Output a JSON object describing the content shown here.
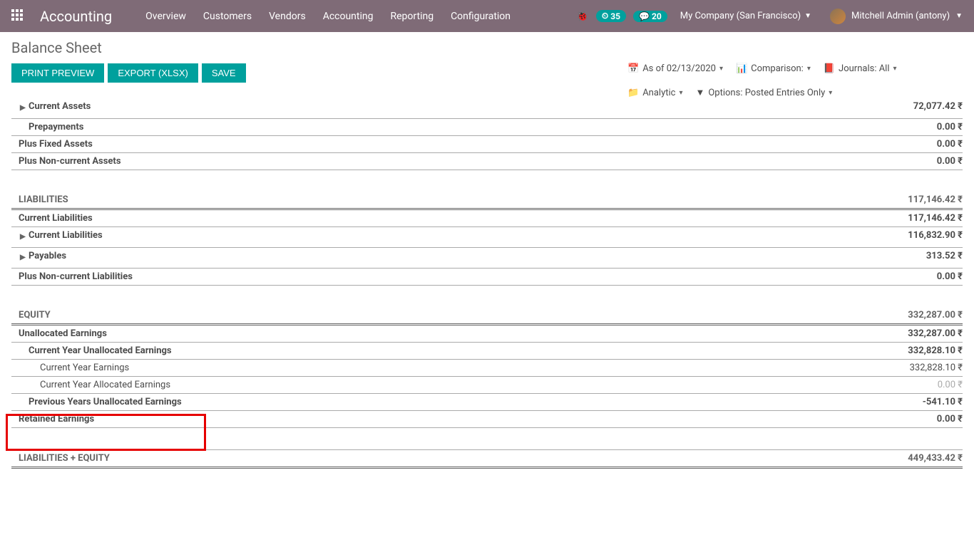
{
  "navbar": {
    "brand": "Accounting",
    "links": [
      "Overview",
      "Customers",
      "Vendors",
      "Accounting",
      "Reporting",
      "Configuration"
    ],
    "badge1": "35",
    "badge2": "20",
    "company": "My Company (San Francisco)",
    "user": "Mitchell Admin (antony)"
  },
  "page": {
    "title": "Balance Sheet",
    "buttons": {
      "print": "PRINT PREVIEW",
      "export": "EXPORT (XLSX)",
      "save": "SAVE"
    }
  },
  "filters": {
    "asof": "As of 02/13/2020",
    "comparison": "Comparison:",
    "journals": "Journals: All",
    "analytic": "Analytic",
    "options": "Options: Posted Entries Only"
  },
  "rows": [
    {
      "label": "Current Assets",
      "value": "72,077.42 ₹",
      "indent": 1,
      "bold": true,
      "expand": true
    },
    {
      "label": "Prepayments",
      "value": "0.00 ₹",
      "indent": 1,
      "bold": true
    },
    {
      "label": "Plus Fixed Assets",
      "value": "0.00 ₹",
      "indent": 0,
      "bold": true
    },
    {
      "label": "Plus Non-current Assets",
      "value": "0.00 ₹",
      "indent": 0,
      "bold": true
    }
  ],
  "liabilities": {
    "header": "LIABILITIES",
    "header_value": "117,146.42 ₹",
    "rows": [
      {
        "label": "Current Liabilities",
        "value": "117,146.42 ₹",
        "indent": 0,
        "bold": true
      },
      {
        "label": "Current Liabilities",
        "value": "116,832.90 ₹",
        "indent": 1,
        "bold": true,
        "expand": true
      },
      {
        "label": "Payables",
        "value": "313.52 ₹",
        "indent": 1,
        "bold": true,
        "expand": true
      },
      {
        "label": "Plus Non-current Liabilities",
        "value": "0.00 ₹",
        "indent": 0,
        "bold": true
      }
    ]
  },
  "equity": {
    "header": "EQUITY",
    "header_value": "332,287.00 ₹",
    "rows": [
      {
        "label": "Unallocated Earnings",
        "value": "332,287.00 ₹",
        "indent": 0,
        "bold": true
      },
      {
        "label": "Current Year Unallocated Earnings",
        "value": "332,828.10 ₹",
        "indent": 1,
        "bold": true
      },
      {
        "label": "Current Year Earnings",
        "value": "332,828.10 ₹",
        "indent": 2
      },
      {
        "label": "Current Year Allocated Earnings",
        "value": "0.00 ₹",
        "indent": 2,
        "muted": true
      },
      {
        "label": "Previous Years Unallocated Earnings",
        "value": "-541.10 ₹",
        "indent": 1,
        "bold": true
      },
      {
        "label": "Retained Earnings",
        "value": "0.00 ₹",
        "indent": 0,
        "bold": true
      }
    ]
  },
  "total": {
    "label": "LIABILITIES + EQUITY",
    "value": "449,433.42 ₹"
  }
}
